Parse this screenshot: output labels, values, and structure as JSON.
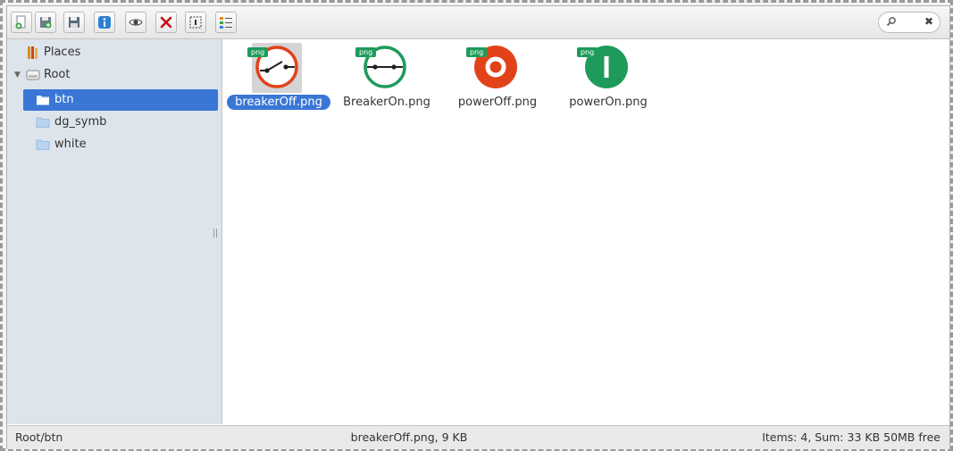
{
  "toolbar": {
    "buttons": [
      "new-file-icon",
      "save-as-icon",
      "save-icon",
      "info-icon",
      "view-icon",
      "delete-icon",
      "select-icon",
      "details-icon"
    ],
    "search": {
      "placeholder": "",
      "clear": "✖"
    }
  },
  "sidebar": {
    "places": "Places",
    "root": "Root",
    "items": [
      "btn",
      "dg_symb",
      "white"
    ]
  },
  "files": [
    {
      "name": "breakerOff.png",
      "badge": "png"
    },
    {
      "name": "BreakerOn.png",
      "badge": "png"
    },
    {
      "name": "powerOff.png",
      "badge": "png"
    },
    {
      "name": "powerOn.png",
      "badge": "png"
    }
  ],
  "status": {
    "path": "Root/btn",
    "selection": "breakerOff.png, 9 KB",
    "summary": "Items: 4, Sum: 33 KB 50MB free"
  },
  "colors": {
    "accent": "#3a76d6",
    "off_red": "#e2421a",
    "on_green": "#1e9b5a"
  }
}
